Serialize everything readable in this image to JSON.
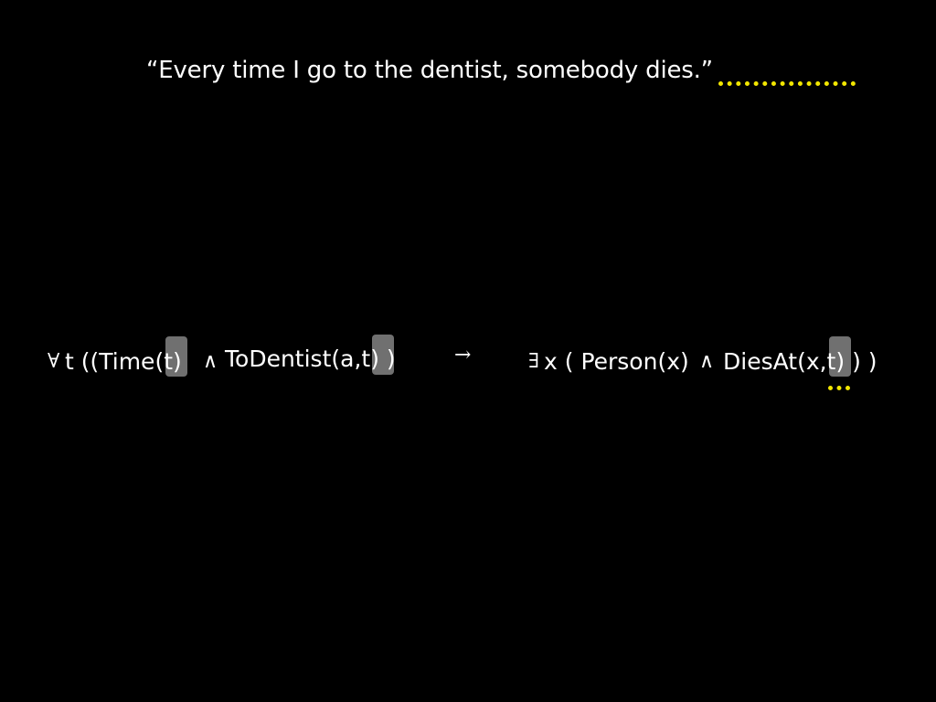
{
  "slide": {
    "quote": "“Every time I go to the dentist, somebody dies.”",
    "formula": {
      "forall_symbol": "∀",
      "part1": "t ((Time(t)",
      "and1_symbol": "∧",
      "part2": "ToDentist(a,t) )",
      "implies_symbol": "→",
      "exists_symbol": "∃",
      "part3": "x ( Person(x)",
      "and2_symbol": "∧",
      "part4": "DiesAt(x,t) ) )"
    },
    "colors": {
      "background": "#000000",
      "text": "#ffffff",
      "highlight": "#707070",
      "accent_dots": "#f2e600"
    }
  }
}
